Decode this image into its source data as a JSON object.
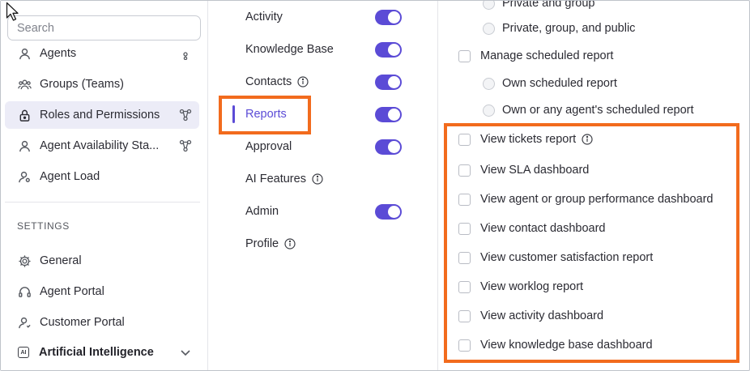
{
  "sidebar": {
    "search_placeholder": "Search",
    "items": [
      {
        "label": "Agents",
        "icon": "agent-icon"
      },
      {
        "label": "Groups (Teams)",
        "icon": "groups-icon"
      },
      {
        "label": "Roles and Permissions",
        "icon": "lock-icon"
      },
      {
        "label": "Agent Availability Sta...",
        "icon": "agent-icon"
      },
      {
        "label": "Agent Load",
        "icon": "agent-settings-icon"
      }
    ],
    "section_title": "SETTINGS",
    "settings_items": [
      {
        "label": "General",
        "icon": "gear-icon"
      },
      {
        "label": "Agent Portal",
        "icon": "headset-icon"
      },
      {
        "label": "Customer Portal",
        "icon": "user-icon"
      },
      {
        "label": "Artificial Intelligence",
        "icon": "ai-icon"
      }
    ]
  },
  "modules": [
    {
      "label": "Activity",
      "toggle": true
    },
    {
      "label": "Knowledge Base",
      "toggle": true
    },
    {
      "label": "Contacts",
      "toggle": true,
      "info": true
    },
    {
      "label": "Reports",
      "toggle": true,
      "selected": true
    },
    {
      "label": "Approval",
      "toggle": true
    },
    {
      "label": "AI Features",
      "toggle": false,
      "info": true
    },
    {
      "label": "Admin",
      "toggle": true
    },
    {
      "label": "Profile",
      "toggle": false,
      "info": true
    }
  ],
  "permissions": {
    "partial_top": "Private and group",
    "radio_top": "Private, group, and public",
    "manage_scheduled": "Manage scheduled report",
    "radio_own": "Own scheduled report",
    "radio_any": "Own or any agent's scheduled report",
    "view_items": [
      "View tickets report",
      "View SLA dashboard",
      "View agent or group performance dashboard",
      "View contact dashboard",
      "View customer satisfaction report",
      "View worklog report",
      "View activity dashboard",
      "View knowledge base dashboard"
    ]
  },
  "colors": {
    "accent": "#5b4bd6",
    "highlight": "#f26b1d",
    "active_bg": "#ececf7"
  }
}
